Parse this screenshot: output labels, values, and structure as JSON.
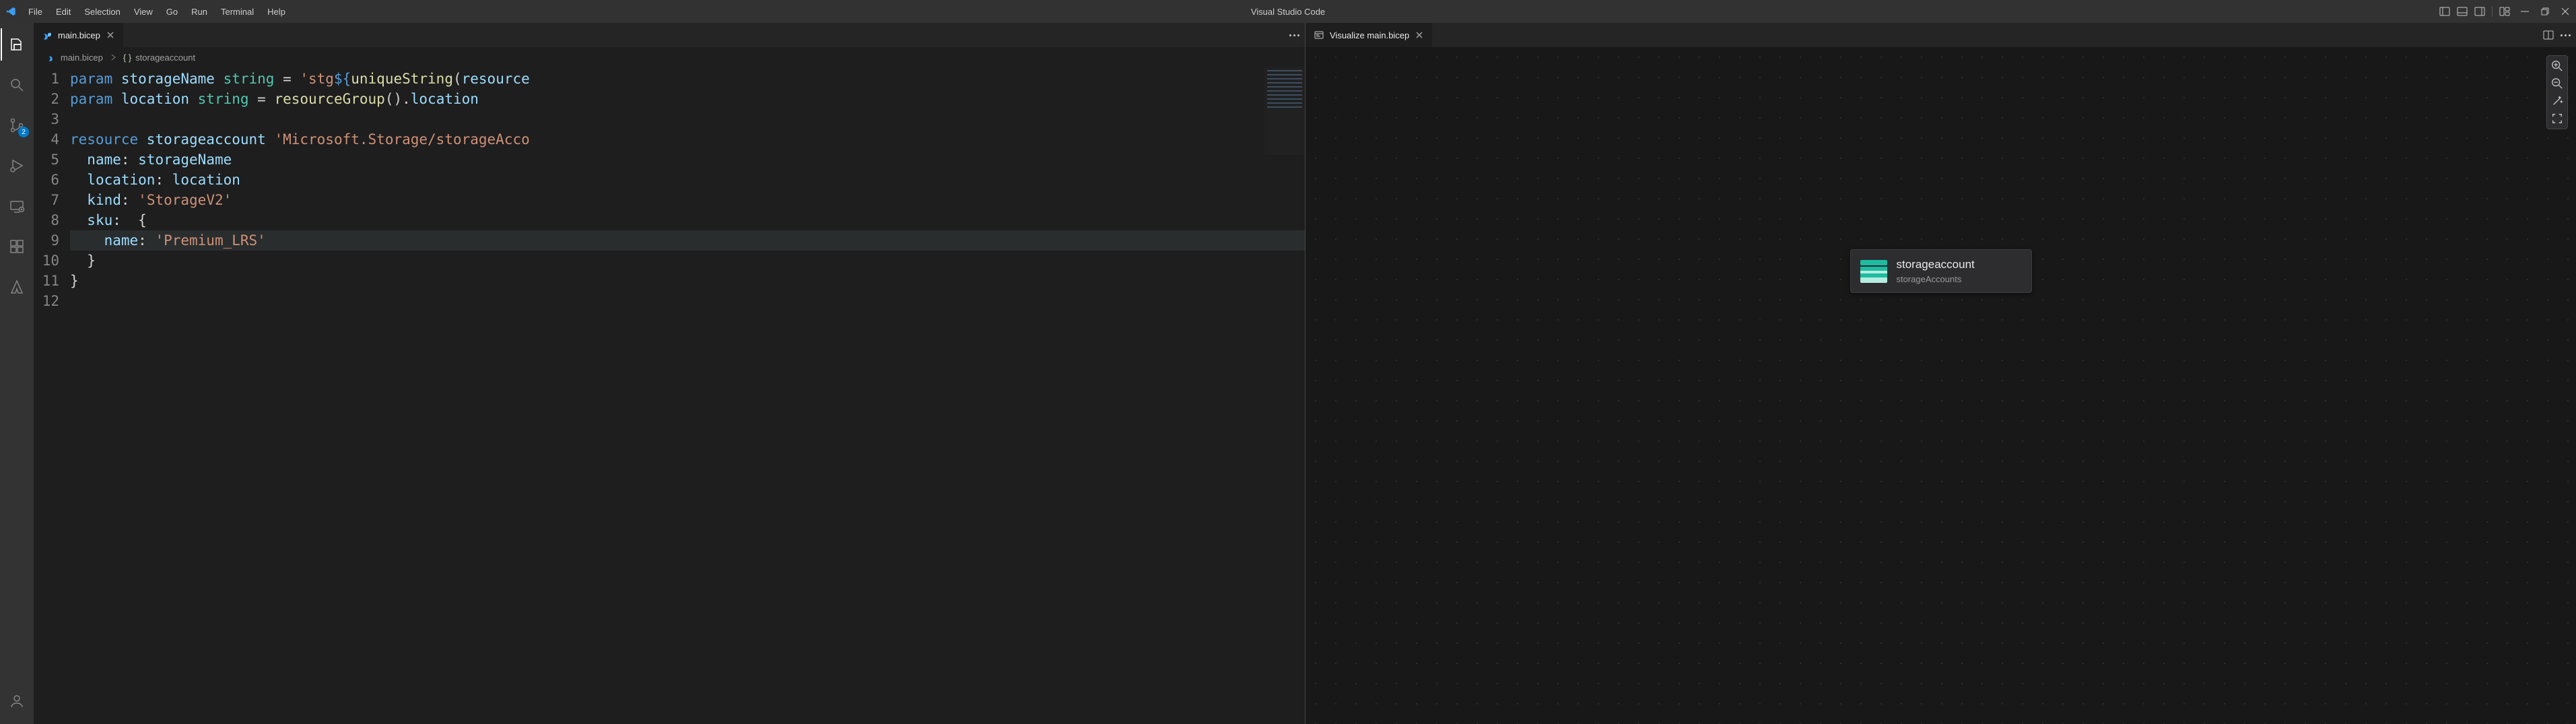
{
  "app": {
    "title": "Visual Studio Code"
  },
  "menu": {
    "items": [
      "File",
      "Edit",
      "Selection",
      "View",
      "Go",
      "Run",
      "Terminal",
      "Help"
    ]
  },
  "activitybar": {
    "badge_scm": "2"
  },
  "editor_tab": {
    "label": "main.bicep"
  },
  "breadcrumb": {
    "file": "main.bicep",
    "symbol": "storageaccount"
  },
  "code": {
    "lines": [
      {
        "n": "1",
        "seg": [
          [
            "kw",
            "param "
          ],
          [
            "id",
            "storageName "
          ],
          [
            "typ",
            "string"
          ],
          [
            "pun",
            " = "
          ],
          [
            "str",
            "'stg"
          ],
          [
            "kw",
            "${"
          ],
          [
            "fn",
            "uniqueString"
          ],
          [
            "pun",
            "("
          ],
          [
            "id",
            "resource"
          ]
        ]
      },
      {
        "n": "2",
        "seg": [
          [
            "kw",
            "param "
          ],
          [
            "id",
            "location "
          ],
          [
            "typ",
            "string"
          ],
          [
            "pun",
            " = "
          ],
          [
            "fn",
            "resourceGroup"
          ],
          [
            "pun",
            "()"
          ],
          [
            "pun",
            "."
          ],
          [
            "id",
            "location"
          ]
        ]
      },
      {
        "n": "3",
        "seg": []
      },
      {
        "n": "4",
        "seg": [
          [
            "kw",
            "resource "
          ],
          [
            "id",
            "storageaccount "
          ],
          [
            "str",
            "'Microsoft.Storage/storageAcco"
          ]
        ]
      },
      {
        "n": "5",
        "seg": [
          [
            "pun",
            "  "
          ],
          [
            "id",
            "name"
          ],
          [
            "pun",
            ": "
          ],
          [
            "id",
            "storageName"
          ]
        ]
      },
      {
        "n": "6",
        "seg": [
          [
            "pun",
            "  "
          ],
          [
            "id",
            "location"
          ],
          [
            "pun",
            ": "
          ],
          [
            "id",
            "location"
          ]
        ]
      },
      {
        "n": "7",
        "seg": [
          [
            "pun",
            "  "
          ],
          [
            "id",
            "kind"
          ],
          [
            "pun",
            ": "
          ],
          [
            "str",
            "'StorageV2'"
          ]
        ]
      },
      {
        "n": "8",
        "seg": [
          [
            "pun",
            "  "
          ],
          [
            "id",
            "sku"
          ],
          [
            "pun",
            ": "
          ],
          [
            "pun",
            " {"
          ]
        ]
      },
      {
        "n": "9",
        "hl": true,
        "seg": [
          [
            "pun",
            "    "
          ],
          [
            "id",
            "name"
          ],
          [
            "pun",
            ": "
          ],
          [
            "str",
            "'Premium_LRS'"
          ]
        ]
      },
      {
        "n": "10",
        "seg": [
          [
            "pun",
            "  }"
          ]
        ]
      },
      {
        "n": "11",
        "seg": [
          [
            "pun",
            "}"
          ]
        ]
      },
      {
        "n": "12",
        "seg": []
      }
    ]
  },
  "visualizer_tab": {
    "label": "Visualize main.bicep"
  },
  "viz_node": {
    "title": "storageaccount",
    "type": "storageAccounts"
  },
  "colors": {
    "accent": "#007acc"
  }
}
